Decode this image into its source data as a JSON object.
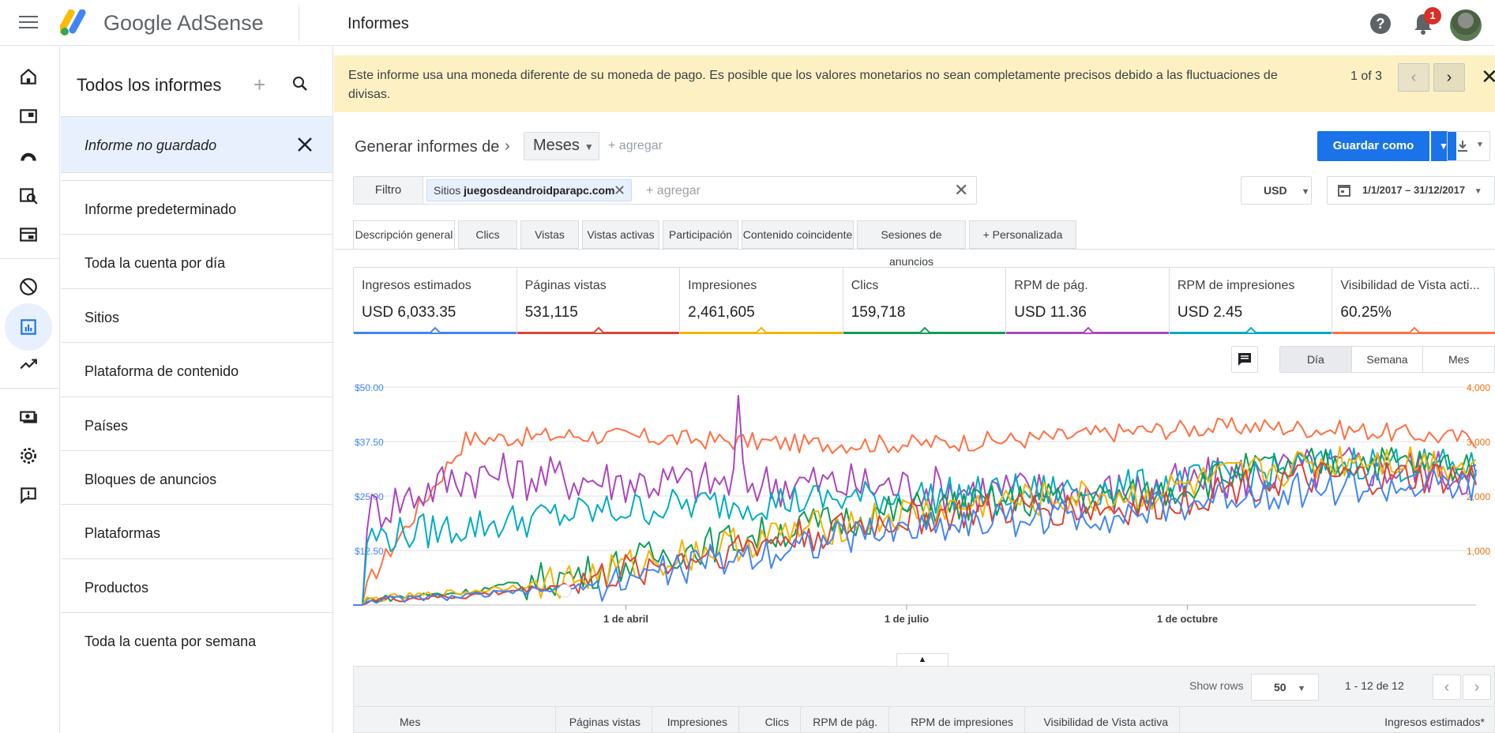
{
  "app": {
    "brand": "Google AdSense",
    "page_title": "Informes",
    "notification_count": "1"
  },
  "sidebar": {
    "title": "Todos los informes",
    "plus": "+",
    "current_report": "Informe no guardado",
    "items": [
      {
        "label": "Informe predeterminado"
      },
      {
        "label": "Toda la cuenta por día"
      },
      {
        "label": "Sitios"
      },
      {
        "label": "Plataforma de contenido"
      },
      {
        "label": "Países"
      },
      {
        "label": "Bloques de anuncios"
      },
      {
        "label": "Plataformas"
      },
      {
        "label": "Productos"
      },
      {
        "label": "Toda la cuenta por semana"
      }
    ]
  },
  "notice": {
    "text": "Este informe usa una moneda diferente de su moneda de pago. Es posible que los valores monetarios no sean completamente precisos debido a las fluctuaciones de divisas.",
    "count": "1 of 3",
    "prev": "‹",
    "next": "›",
    "close": "✕"
  },
  "toolbar": {
    "generate_label": "Generar informes de",
    "dimension": "Meses",
    "add_dimension": "+ agregar",
    "save_label": "Guardar como",
    "filter_label": "Filtro",
    "filter_chip_prefix": "Sitios",
    "filter_chip_value": "juegosdeandroidparapc.com",
    "filter_add": "+ agregar",
    "currency": "USD",
    "date_range": "1/1/2017 – 31/12/2017"
  },
  "tabs": [
    {
      "label": "Descripción general"
    },
    {
      "label": "Clics"
    },
    {
      "label": "Vistas"
    },
    {
      "label": "Vistas activas"
    },
    {
      "label": "Participación"
    },
    {
      "label": "Contenido coincidente"
    },
    {
      "label": "Sesiones de anuncios"
    },
    {
      "label": "+  Personalizada"
    }
  ],
  "kpis": [
    {
      "label": "Ingresos estimados",
      "value": "USD 6,033.35",
      "color": "#4285f4"
    },
    {
      "label": "Páginas vistas",
      "value": "531,115",
      "color": "#db4437"
    },
    {
      "label": "Impresiones",
      "value": "2,461,605",
      "color": "#f4b400"
    },
    {
      "label": "Clics",
      "value": "159,718",
      "color": "#0f9d58"
    },
    {
      "label": "RPM de pág.",
      "value": "USD 11.36",
      "color": "#ab47bc"
    },
    {
      "label": "RPM de impresiones",
      "value": "USD 2.45",
      "color": "#00acc1"
    },
    {
      "label": "Visibilidad de Vista acti...",
      "value": "60.25%",
      "color": "#ff7043"
    }
  ],
  "granularity": {
    "options": [
      "Día",
      "Semana",
      "Mes"
    ],
    "selected": "Día"
  },
  "chart_data": {
    "type": "line",
    "left_ticks": [
      "$50.00",
      "$37.50",
      "$25.00",
      "$12.50"
    ],
    "right_ticks": [
      "4,000",
      "3,000",
      "2,000",
      "1,000"
    ],
    "x_labels": [
      "1 de abril",
      "1 de julio",
      "1 de octubre"
    ],
    "ylim_left": [
      0,
      50
    ],
    "ylim_right": [
      0,
      4000
    ],
    "series_colors": [
      "#4285f4",
      "#db4437",
      "#f4b400",
      "#0f9d58",
      "#ab47bc",
      "#00acc1",
      "#ff7043"
    ],
    "approx_trend_left": {
      "orange": [
        0,
        38,
        39,
        38,
        37,
        37,
        38,
        40,
        41,
        40,
        38
      ],
      "purple": [
        20,
        30,
        29,
        28,
        28,
        27,
        26,
        26,
        30,
        32,
        30
      ],
      "teal": [
        15,
        18,
        21,
        23,
        24,
        25,
        26,
        27,
        30,
        33,
        31
      ],
      "green": [
        1,
        3,
        7,
        13,
        18,
        22,
        24,
        25,
        31,
        33,
        32
      ],
      "yellow": [
        1,
        3,
        6,
        12,
        17,
        21,
        24,
        25,
        30,
        34,
        32
      ],
      "red": [
        1,
        2,
        5,
        11,
        16,
        20,
        22,
        22,
        28,
        29,
        29
      ],
      "blue": [
        1,
        2,
        4,
        9,
        14,
        18,
        20,
        21,
        26,
        27,
        27
      ]
    }
  },
  "table": {
    "show_rows_label": "Show rows",
    "rows": "50",
    "range": "1 - 12 de 12",
    "columns": [
      "Mes",
      "Páginas vistas",
      "Impresiones",
      "Clics",
      "RPM de pág.",
      "RPM de impresiones",
      "Visibilidad de Vista activa",
      "Ingresos estimados*"
    ]
  }
}
